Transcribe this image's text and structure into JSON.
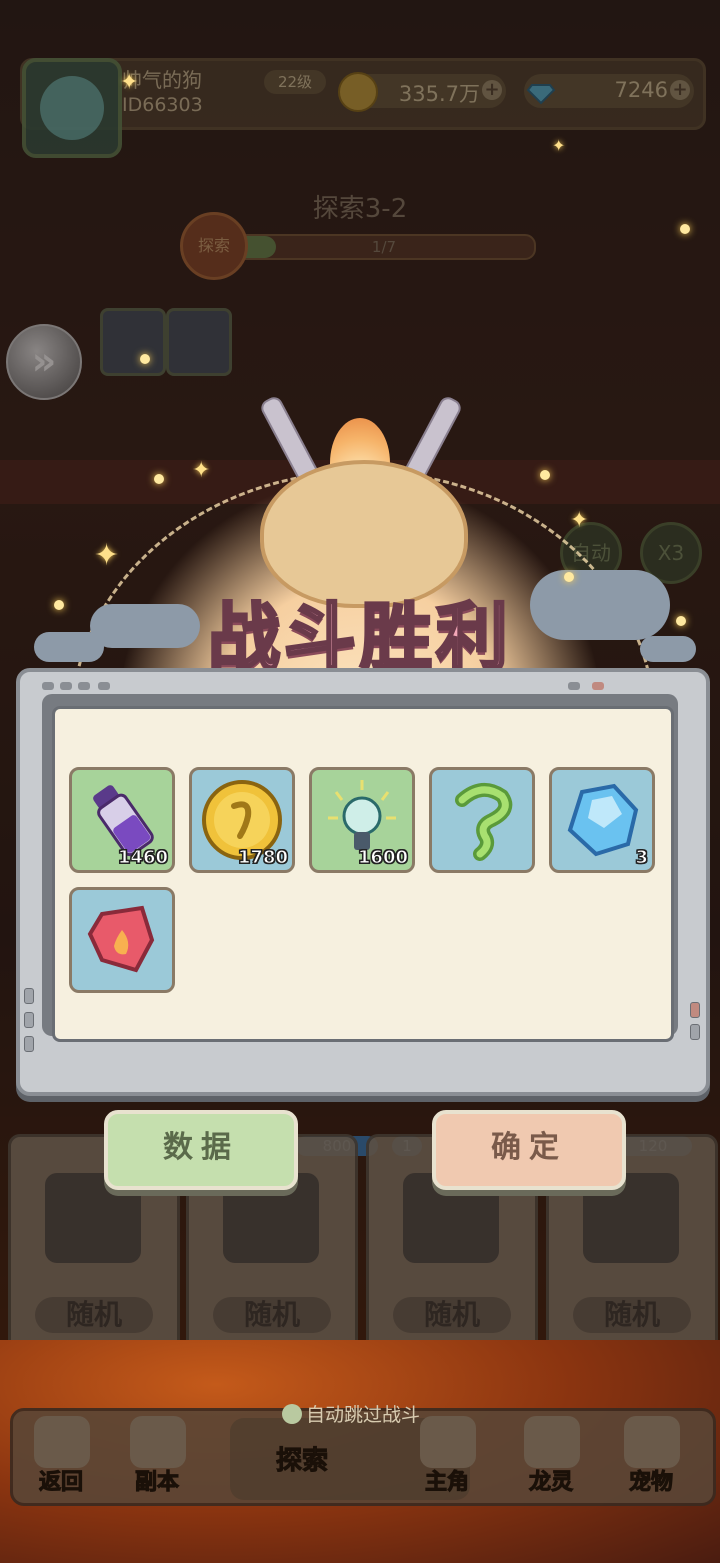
{
  "player": {
    "name": "帅气的狗",
    "id_prefix": "ID",
    "id": "66303",
    "level": "22级",
    "gold": "335.7万",
    "gems": "7246"
  },
  "stage": {
    "title": "探索3-2",
    "explore_badge": "探索",
    "progress_text": "1/7",
    "progress_fraction": 0.14
  },
  "battle_speed": {
    "auto": "自动",
    "speed": "X3"
  },
  "result": {
    "title": "战斗胜利"
  },
  "rewards": [
    {
      "name": "purple-potion",
      "qty": "1460",
      "bg": "green"
    },
    {
      "name": "gold-coin",
      "qty": "1780",
      "bg": "blue"
    },
    {
      "name": "lightbulb-essence",
      "qty": "1600",
      "bg": "green"
    },
    {
      "name": "green-spirit",
      "qty": "",
      "bg": "blue"
    },
    {
      "name": "blue-crystal",
      "qty": "3",
      "bg": "blue"
    },
    {
      "name": "red-ember",
      "qty": "",
      "bg": "blue"
    }
  ],
  "buttons": {
    "data": "数据",
    "confirm": "确定"
  },
  "cards": {
    "random_label": "随机",
    "tags": [
      "800",
      "1",
      "120"
    ]
  },
  "nav": {
    "auto_skip": "自动跳过战斗",
    "items": [
      {
        "label": "返回"
      },
      {
        "label": "副本"
      },
      {
        "label": "探索"
      },
      {
        "label": "主角"
      },
      {
        "label": "龙灵"
      },
      {
        "label": "宠物"
      }
    ]
  },
  "colors": {
    "paper": "#f6f0df",
    "dialog_frame": "#c8cbcf",
    "title_pink": "#f4a8b8",
    "data_button": "#c5dfae",
    "confirm_button": "#f0c9b0"
  }
}
